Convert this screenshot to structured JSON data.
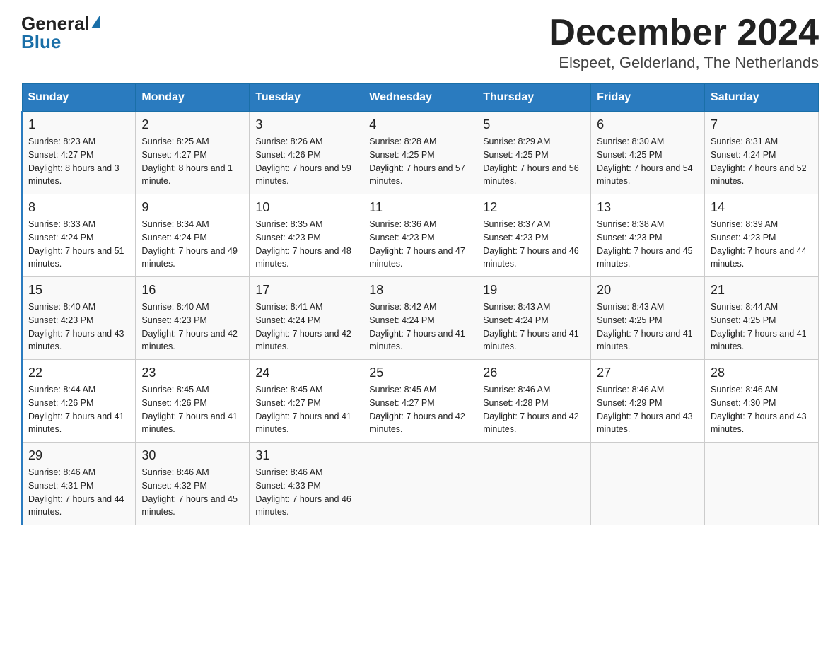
{
  "header": {
    "logo_general": "General",
    "logo_blue": "Blue",
    "month": "December 2024",
    "location": "Elspeet, Gelderland, The Netherlands"
  },
  "days_of_week": [
    "Sunday",
    "Monday",
    "Tuesday",
    "Wednesday",
    "Thursday",
    "Friday",
    "Saturday"
  ],
  "weeks": [
    [
      {
        "day": "1",
        "sunrise": "8:23 AM",
        "sunset": "4:27 PM",
        "daylight": "8 hours and 3 minutes."
      },
      {
        "day": "2",
        "sunrise": "8:25 AM",
        "sunset": "4:27 PM",
        "daylight": "8 hours and 1 minute."
      },
      {
        "day": "3",
        "sunrise": "8:26 AM",
        "sunset": "4:26 PM",
        "daylight": "7 hours and 59 minutes."
      },
      {
        "day": "4",
        "sunrise": "8:28 AM",
        "sunset": "4:25 PM",
        "daylight": "7 hours and 57 minutes."
      },
      {
        "day": "5",
        "sunrise": "8:29 AM",
        "sunset": "4:25 PM",
        "daylight": "7 hours and 56 minutes."
      },
      {
        "day": "6",
        "sunrise": "8:30 AM",
        "sunset": "4:25 PM",
        "daylight": "7 hours and 54 minutes."
      },
      {
        "day": "7",
        "sunrise": "8:31 AM",
        "sunset": "4:24 PM",
        "daylight": "7 hours and 52 minutes."
      }
    ],
    [
      {
        "day": "8",
        "sunrise": "8:33 AM",
        "sunset": "4:24 PM",
        "daylight": "7 hours and 51 minutes."
      },
      {
        "day": "9",
        "sunrise": "8:34 AM",
        "sunset": "4:24 PM",
        "daylight": "7 hours and 49 minutes."
      },
      {
        "day": "10",
        "sunrise": "8:35 AM",
        "sunset": "4:23 PM",
        "daylight": "7 hours and 48 minutes."
      },
      {
        "day": "11",
        "sunrise": "8:36 AM",
        "sunset": "4:23 PM",
        "daylight": "7 hours and 47 minutes."
      },
      {
        "day": "12",
        "sunrise": "8:37 AM",
        "sunset": "4:23 PM",
        "daylight": "7 hours and 46 minutes."
      },
      {
        "day": "13",
        "sunrise": "8:38 AM",
        "sunset": "4:23 PM",
        "daylight": "7 hours and 45 minutes."
      },
      {
        "day": "14",
        "sunrise": "8:39 AM",
        "sunset": "4:23 PM",
        "daylight": "7 hours and 44 minutes."
      }
    ],
    [
      {
        "day": "15",
        "sunrise": "8:40 AM",
        "sunset": "4:23 PM",
        "daylight": "7 hours and 43 minutes."
      },
      {
        "day": "16",
        "sunrise": "8:40 AM",
        "sunset": "4:23 PM",
        "daylight": "7 hours and 42 minutes."
      },
      {
        "day": "17",
        "sunrise": "8:41 AM",
        "sunset": "4:24 PM",
        "daylight": "7 hours and 42 minutes."
      },
      {
        "day": "18",
        "sunrise": "8:42 AM",
        "sunset": "4:24 PM",
        "daylight": "7 hours and 41 minutes."
      },
      {
        "day": "19",
        "sunrise": "8:43 AM",
        "sunset": "4:24 PM",
        "daylight": "7 hours and 41 minutes."
      },
      {
        "day": "20",
        "sunrise": "8:43 AM",
        "sunset": "4:25 PM",
        "daylight": "7 hours and 41 minutes."
      },
      {
        "day": "21",
        "sunrise": "8:44 AM",
        "sunset": "4:25 PM",
        "daylight": "7 hours and 41 minutes."
      }
    ],
    [
      {
        "day": "22",
        "sunrise": "8:44 AM",
        "sunset": "4:26 PM",
        "daylight": "7 hours and 41 minutes."
      },
      {
        "day": "23",
        "sunrise": "8:45 AM",
        "sunset": "4:26 PM",
        "daylight": "7 hours and 41 minutes."
      },
      {
        "day": "24",
        "sunrise": "8:45 AM",
        "sunset": "4:27 PM",
        "daylight": "7 hours and 41 minutes."
      },
      {
        "day": "25",
        "sunrise": "8:45 AM",
        "sunset": "4:27 PM",
        "daylight": "7 hours and 42 minutes."
      },
      {
        "day": "26",
        "sunrise": "8:46 AM",
        "sunset": "4:28 PM",
        "daylight": "7 hours and 42 minutes."
      },
      {
        "day": "27",
        "sunrise": "8:46 AM",
        "sunset": "4:29 PM",
        "daylight": "7 hours and 43 minutes."
      },
      {
        "day": "28",
        "sunrise": "8:46 AM",
        "sunset": "4:30 PM",
        "daylight": "7 hours and 43 minutes."
      }
    ],
    [
      {
        "day": "29",
        "sunrise": "8:46 AM",
        "sunset": "4:31 PM",
        "daylight": "7 hours and 44 minutes."
      },
      {
        "day": "30",
        "sunrise": "8:46 AM",
        "sunset": "4:32 PM",
        "daylight": "7 hours and 45 minutes."
      },
      {
        "day": "31",
        "sunrise": "8:46 AM",
        "sunset": "4:33 PM",
        "daylight": "7 hours and 46 minutes."
      },
      {
        "day": "",
        "sunrise": "",
        "sunset": "",
        "daylight": ""
      },
      {
        "day": "",
        "sunrise": "",
        "sunset": "",
        "daylight": ""
      },
      {
        "day": "",
        "sunrise": "",
        "sunset": "",
        "daylight": ""
      },
      {
        "day": "",
        "sunrise": "",
        "sunset": "",
        "daylight": ""
      }
    ]
  ]
}
